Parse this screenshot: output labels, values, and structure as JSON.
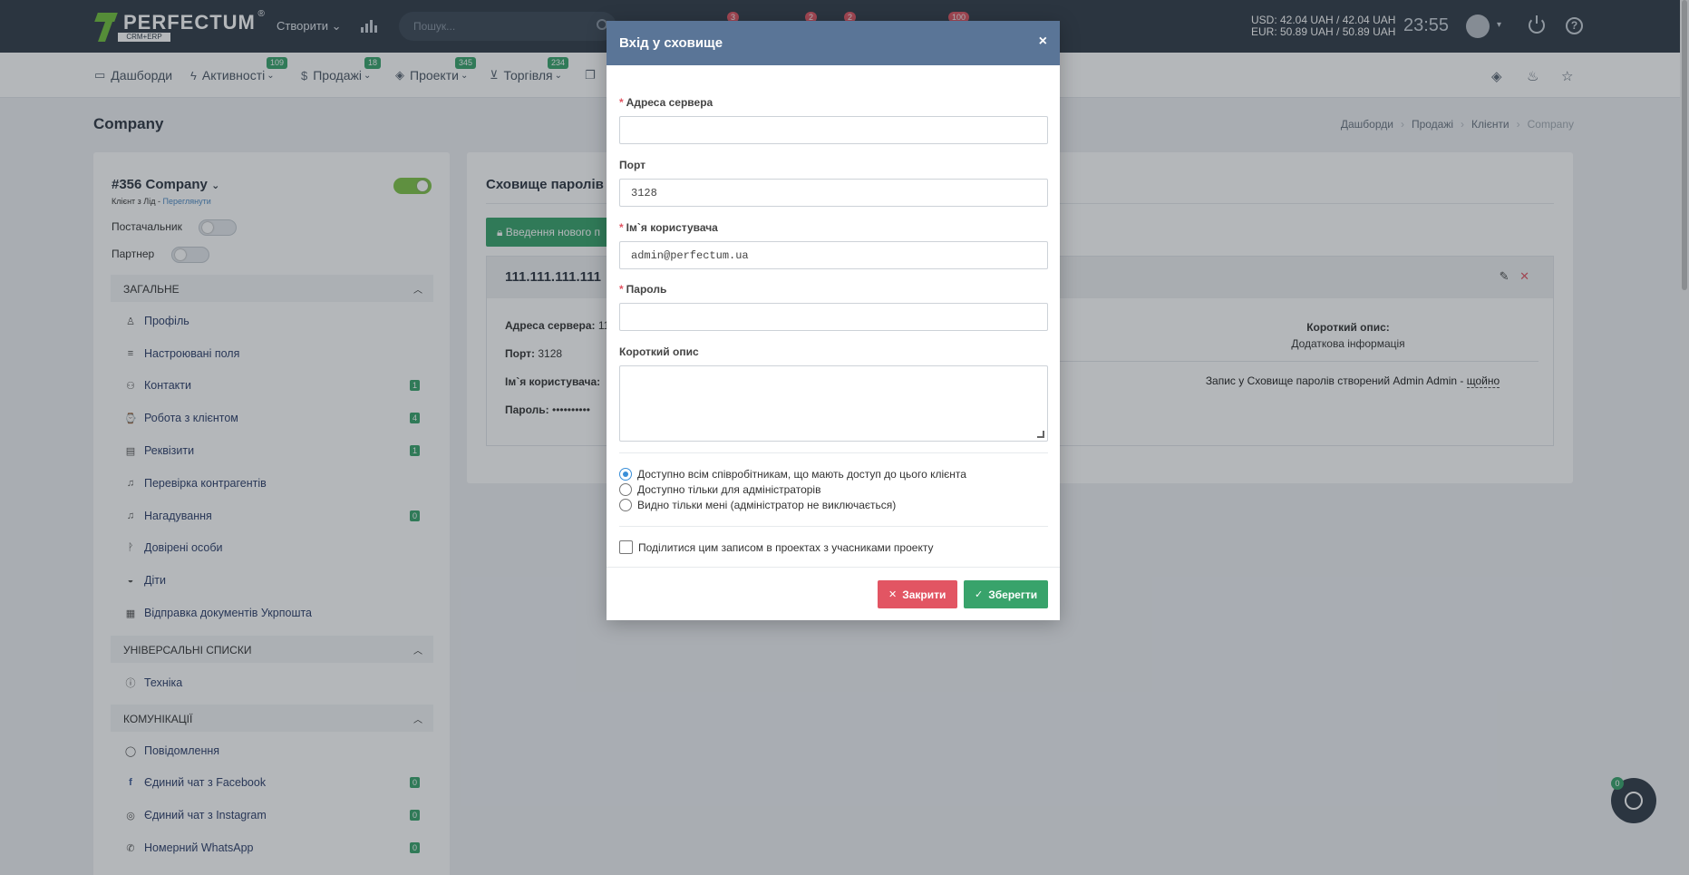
{
  "topbar": {
    "logo_text": "PERFECTUM",
    "logo_sub": "CRM+ERP",
    "logo_reg": "®",
    "create_label": "Створити",
    "search_placeholder": "Пошук...",
    "badges": [
      "3",
      "2",
      "2",
      "100"
    ],
    "currency_usd": "USD: 42.04 UAH / 42.04 UAH",
    "currency_eur": "EUR: 50.89 UAH / 50.89 UAH",
    "time": "23:55"
  },
  "nav": [
    {
      "label": "Дашборди",
      "icon": "dashboard-icon",
      "badge": ""
    },
    {
      "label": "Активності",
      "icon": "bolt-icon",
      "badge": "109"
    },
    {
      "label": "Продажі",
      "icon": "dollar-icon",
      "badge": "18"
    },
    {
      "label": "Проекти",
      "icon": "layers-icon",
      "badge": "345"
    },
    {
      "label": "Торгівля",
      "icon": "cart-icon",
      "badge": "234"
    }
  ],
  "page": {
    "title": "Company",
    "breadcrumb": [
      "Дашборди",
      "Продажі",
      "Клієнти",
      "Company"
    ]
  },
  "left": {
    "company_title": "#356 Company",
    "company_sub": "Клієнт з Лід - ",
    "company_sub_link": "Переглянути",
    "supplier_label": "Постачальник",
    "partner_label": "Партнер",
    "sections": {
      "general": "ЗАГАЛЬНЕ",
      "universal": "УНІВЕРСАЛЬНІ СПИСКИ",
      "comms": "КОМУНІКАЦІЇ"
    },
    "general_items": [
      {
        "label": "Профіль",
        "icon": "user-icon",
        "count": ""
      },
      {
        "label": "Настроювані поля",
        "icon": "list-icon",
        "count": ""
      },
      {
        "label": "Контакти",
        "icon": "users-icon",
        "count": "1"
      },
      {
        "label": "Робота з клієнтом",
        "icon": "handshake-icon",
        "count": "4"
      },
      {
        "label": "Реквізити",
        "icon": "id-card-icon",
        "count": "1"
      },
      {
        "label": "Перевірка контрагентів",
        "icon": "bell-icon",
        "count": ""
      },
      {
        "label": "Нагадування",
        "icon": "bell-icon",
        "count": "0"
      },
      {
        "label": "Довірені особи",
        "icon": "person-icon",
        "count": ""
      },
      {
        "label": "Діти",
        "icon": "child-icon",
        "count": ""
      },
      {
        "label": "Відправка документів Укрпошта",
        "icon": "boxes-icon",
        "count": ""
      }
    ],
    "universal_items": [
      {
        "label": "Техніка",
        "icon": "info-icon",
        "count": ""
      }
    ],
    "comms_items": [
      {
        "label": "Повідомлення",
        "icon": "message-icon",
        "count": ""
      },
      {
        "label": "Єдиний чат з Facebook",
        "icon": "facebook-icon",
        "count": "0"
      },
      {
        "label": "Єдиний чат з Instagram",
        "icon": "instagram-icon",
        "count": "0"
      },
      {
        "label": "Номерний WhatsApp",
        "icon": "whatsapp-icon",
        "count": "0"
      }
    ]
  },
  "vault": {
    "title": "Сховище паролів",
    "add_button": "Введення нового п",
    "entry_title": "111.111.111.111",
    "server_label": "Адреса сервера:",
    "server_value": "11",
    "port_label": "Порт:",
    "port_value": "3128",
    "user_label": "Ім`я користувача:",
    "password_label": "Пароль:",
    "password_value": "••••••••••",
    "short_desc_label": "Короткий опис:",
    "short_desc_value": "Додаткова інформація",
    "created_text": "Запис у Сховище паролів створений Admin Admin - ",
    "created_link": "щойно"
  },
  "modal": {
    "title": "Вхід у сховище",
    "close_x": "×",
    "server_label": "Адреса сервера",
    "server_value": "",
    "port_label": "Порт",
    "port_value": "3128",
    "user_label": "Ім`я користувача",
    "user_value": "admin@perfectum.ua",
    "password_label": "Пароль",
    "password_value": "",
    "desc_label": "Короткий опис",
    "desc_value": "",
    "radio_options": [
      "Доступно всім співробітникам, що мають доступ до цього клієнта",
      "Доступно тільки для адміністраторів",
      "Видно тільки мені (адміністратор не виключається)"
    ],
    "selected_radio": 0,
    "share_label": "Поділитися цим записом в проектах з учасниками проекту",
    "close_button": "Закрити",
    "save_button": "Зберегти"
  },
  "chat": {
    "badge": "0"
  }
}
